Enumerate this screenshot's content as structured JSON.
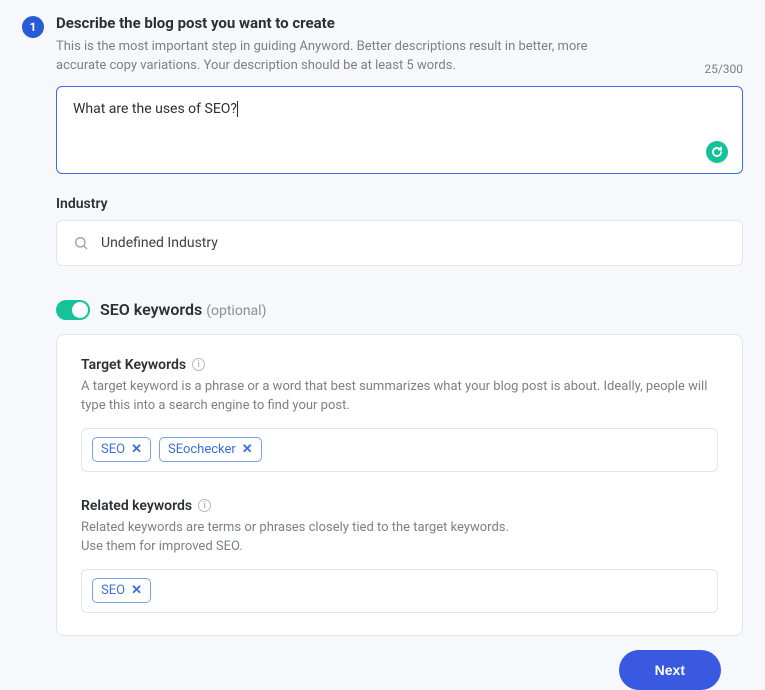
{
  "step": {
    "number": "1",
    "title": "Describe the blog post you want to create",
    "description": "This is the most important step in guiding Anyword. Better descriptions result in better, more accurate copy variations. Your description should be at least 5 words.",
    "char_count": "25/300"
  },
  "description_value": "What are the uses of SEO?",
  "industry": {
    "label": "Industry",
    "value": "Undefined Industry"
  },
  "seo": {
    "title": "SEO keywords",
    "optional": "(optional)",
    "target": {
      "heading": "Target Keywords",
      "desc": "A target keyword is a phrase or a word that best summarizes what your blog post is about. Ideally, people will type this into a search engine to find your post.",
      "tags": [
        "SEO",
        "SEochecker"
      ]
    },
    "related": {
      "heading": "Related keywords",
      "desc": "Related keywords are terms or phrases closely tied to the target keywords.\nUse them for improved SEO.",
      "tags": [
        "SEO"
      ]
    }
  },
  "next_label": "Next"
}
